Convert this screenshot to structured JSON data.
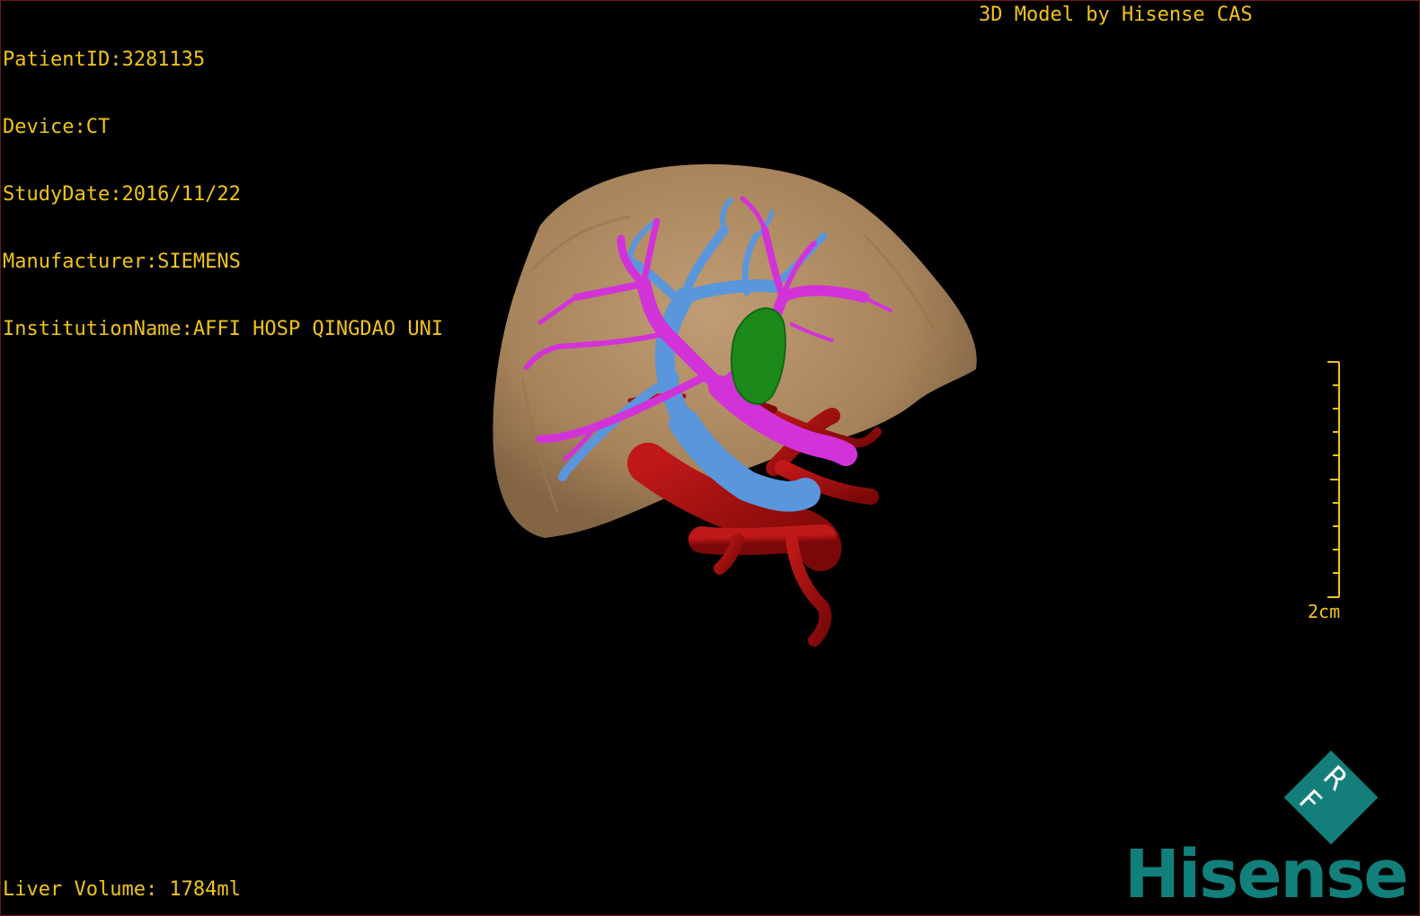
{
  "dicom_info": {
    "patient_id": "PatientID:3281135",
    "device": "Device:CT",
    "study_date": "StudyDate:2016/11/22",
    "manufacturer": "Manufacturer:SIEMENS",
    "institution": "InstitutionName:AFFI HOSP QINGDAO UNI"
  },
  "vendor_label": "3D Model by Hisense CAS",
  "liver_volume": "Liver Volume: 1784ml",
  "scale_bar": {
    "label": "2cm"
  },
  "logo": {
    "badge": "R F",
    "wordmark": "Hisense"
  },
  "colors": {
    "text": "#f0c419",
    "liver": "#b48e64",
    "hepatic_vein": "#5a96dc",
    "portal_vein": "#d233d8",
    "artery": "#a00f0f",
    "gallbladder": "#1b8a1b",
    "brand": "#12807a"
  }
}
